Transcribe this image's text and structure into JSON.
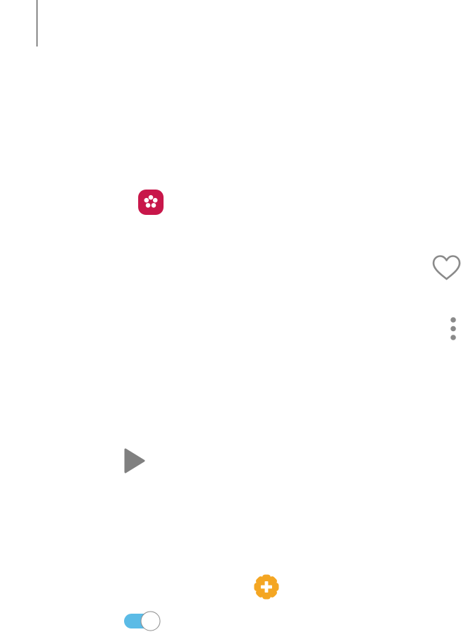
{
  "icons": {
    "gallery": {
      "name": "gallery-app-icon",
      "color": "#c8174a"
    },
    "favorite": {
      "name": "heart-outline-icon",
      "color": "#8a8a8a"
    },
    "more": {
      "name": "more-options-vertical-icon",
      "color": "#8a8a8a"
    },
    "play": {
      "name": "play-icon",
      "color": "#808080"
    },
    "plugin": {
      "name": "add-on-gear-plus-icon",
      "color": "#f4a623"
    }
  },
  "toggle": {
    "state": "on",
    "track_color": "#5bbbe6",
    "thumb_color": "#ffffff"
  }
}
